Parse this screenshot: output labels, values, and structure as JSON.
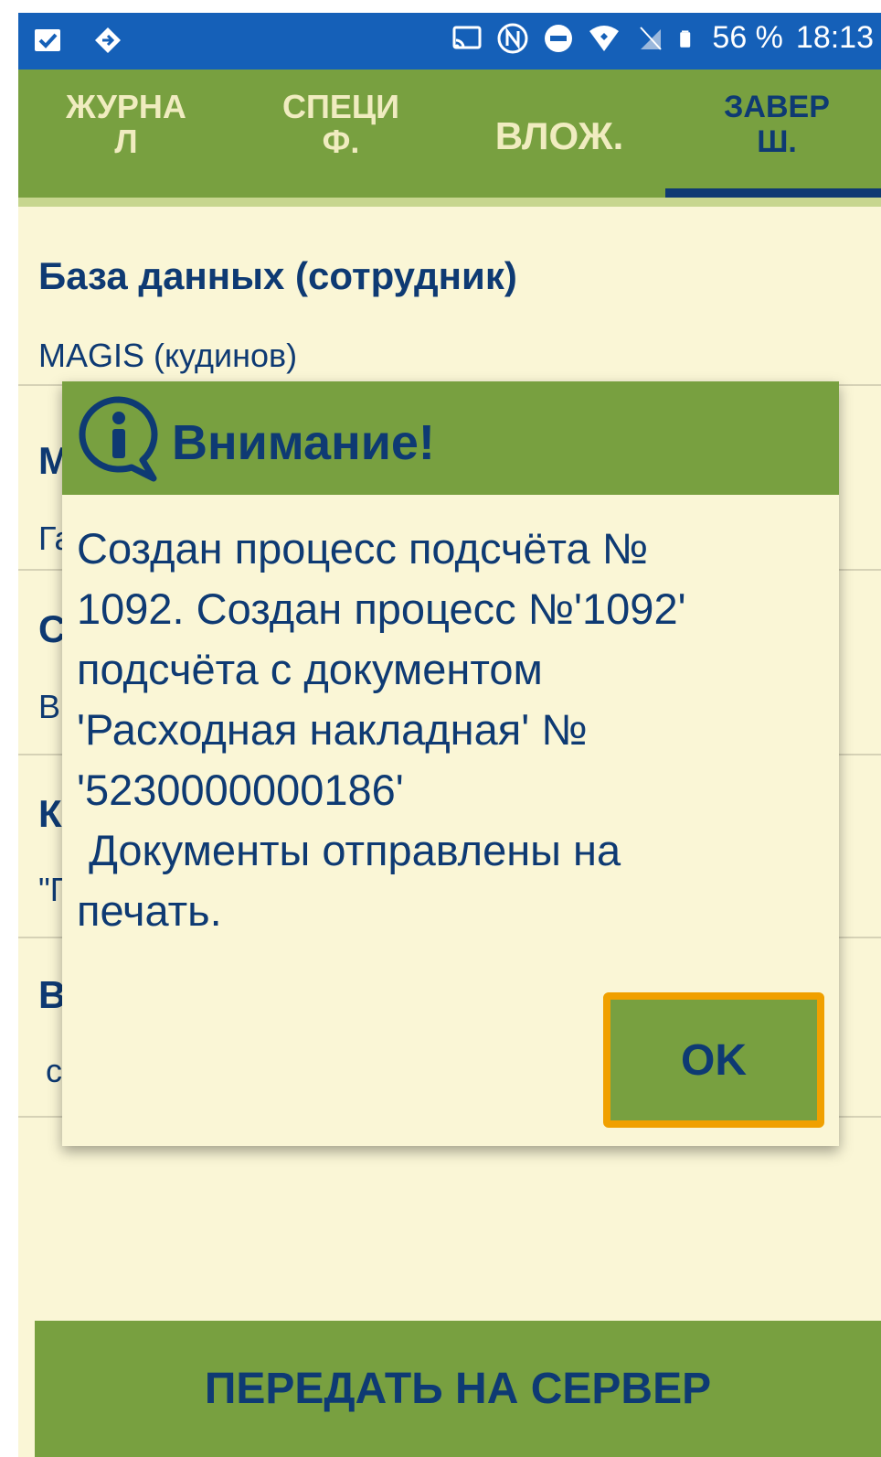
{
  "status_bar": {
    "battery": "56 %",
    "time": "18:13",
    "icons": [
      "clipboard-check-icon",
      "location-arrow-icon",
      "cast-icon",
      "nfc-icon",
      "do-not-disturb-icon",
      "wifi-icon",
      "no-sim-icon",
      "battery-icon"
    ]
  },
  "tabs": [
    {
      "label": "ЖУРНА\nЛ",
      "active": false
    },
    {
      "label": "СПЕЦИ\nФ.",
      "active": false
    },
    {
      "label": "ВЛОЖ.",
      "active": false
    },
    {
      "label": "ЗАВЕР\nШ.",
      "active": true
    }
  ],
  "fields": [
    {
      "label": "База данных (сотрудник)",
      "value": "MAGIS (кудинов)"
    },
    {
      "label": "М",
      "value": "Га"
    },
    {
      "label": "С",
      "value": "В"
    },
    {
      "label": "К",
      "value": "\"Г"
    },
    {
      "label": "В",
      "value": "с"
    }
  ],
  "dialog": {
    "title": "Внимание!",
    "message": "Создан процесс подсчёта №\n1092. Создан процесс №'1092'\nподсчёта с документом\n'Расходная накладная' №\n'5230000000186'\n Документы отправлены на\nпечать.",
    "ok_label": "OK",
    "icon": "info-icon"
  },
  "send_button": "ПЕРЕДАТЬ НА СЕРВЕР",
  "colors": {
    "accent_green": "#78a040",
    "text_navy": "#0e3a73",
    "background": "#faf6d6",
    "status_blue": "#1560b8",
    "focus_orange": "#f0a000"
  }
}
